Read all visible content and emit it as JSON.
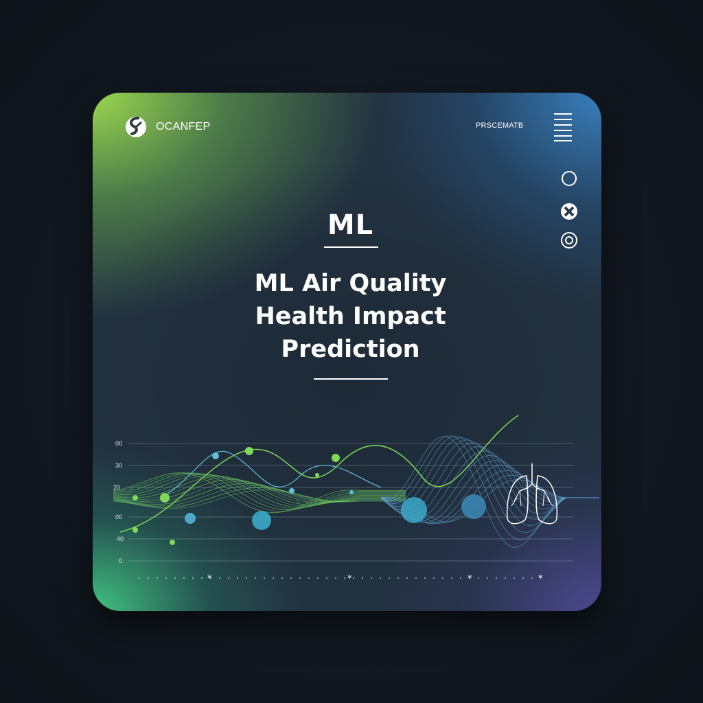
{
  "header": {
    "brand_name": "OCANFEP",
    "top_label": "PRSCEMATB"
  },
  "hero": {
    "tag": "ML",
    "title_lines": [
      "ML Air Quality",
      "Health Impact",
      "Prediction"
    ]
  },
  "chart_data": {
    "type": "line",
    "y_tick_labels": [
      "00",
      "30",
      "20",
      "00",
      "40",
      "0"
    ],
    "grid": true
  },
  "icons": {
    "brand": "brand-logo-icon",
    "menu": "hamburger-menu-icon",
    "side": [
      "ring-icon",
      "close-circle-icon",
      "target-icon"
    ],
    "chart_overlay": "lungs-icon"
  },
  "colors": {
    "accent_green": "#7ed957",
    "accent_blue": "#4fb0d8",
    "text": "#ffffff"
  }
}
